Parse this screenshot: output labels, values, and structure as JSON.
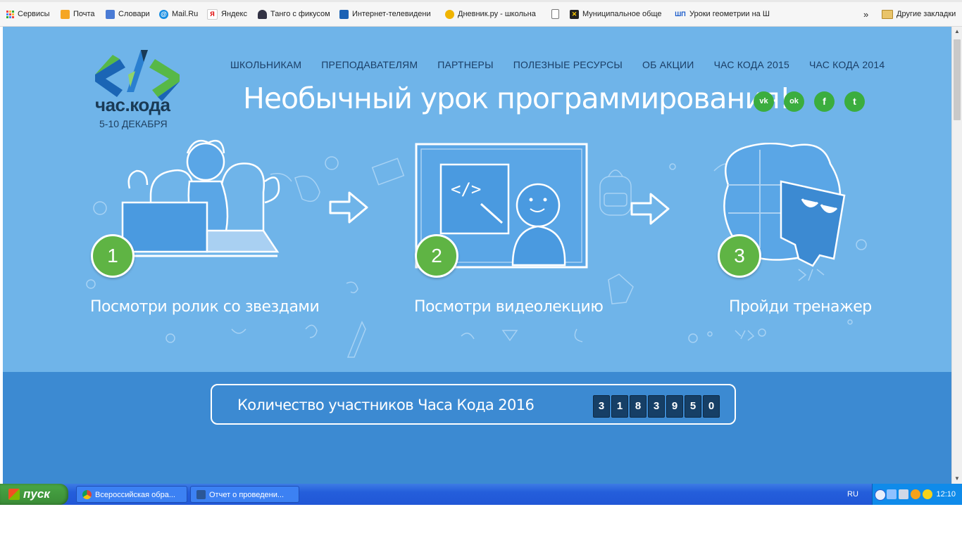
{
  "bookmarks": {
    "items": [
      {
        "label": "Сервисы",
        "icon": "apps-grid-icon",
        "color": "#e44"
      },
      {
        "label": "Почта",
        "icon": "mail-icon",
        "color": "#f5a623"
      },
      {
        "label": "Словари",
        "icon": "dictionary-icon",
        "color": "#4a7bd5"
      },
      {
        "label": "Mail.Ru",
        "icon": "mailru-icon",
        "color": "#168de2"
      },
      {
        "label": "Яндекс",
        "icon": "yandex-icon",
        "color": "#d00"
      },
      {
        "label": "Танго с фикусом",
        "icon": "person-icon",
        "color": "#334"
      },
      {
        "label": "Интернет-телевидени",
        "icon": "tv-icon",
        "color": "#1b62b5"
      },
      {
        "label": "Дневник.ру - школьна",
        "icon": "diary-icon",
        "color": "#f0b400"
      },
      {
        "label": "",
        "icon": "page-icon",
        "color": "#888"
      },
      {
        "label": "Муниципальное обще",
        "icon": "municipal-icon",
        "color": "#c22"
      },
      {
        "label": "Уроки геометрии на Ш",
        "icon": "shp-icon",
        "color": "#1558c9"
      }
    ],
    "overflow": "»",
    "other": "Другие закладки"
  },
  "site": {
    "logo_text": "час.кода",
    "logo_date": "5-10 ДЕКАБРЯ",
    "nav": [
      "ШКОЛЬНИКАМ",
      "ПРЕПОДАВАТЕЛЯМ",
      "ПАРТНЕРЫ",
      "ПОЛЕЗНЫЕ РЕСУРСЫ",
      "ОБ АКЦИИ",
      "ЧАС КОДА 2015",
      "ЧАС КОДА 2014"
    ],
    "headline": "Необычный урок программирования!",
    "social": [
      {
        "name": "vk",
        "glyph": "vk"
      },
      {
        "name": "odnoklassniki",
        "glyph": "ok"
      },
      {
        "name": "facebook",
        "glyph": "f"
      },
      {
        "name": "twitter",
        "glyph": "t"
      }
    ],
    "steps": [
      {
        "number": "1",
        "label": "Посмотри ролик со звездами"
      },
      {
        "number": "2",
        "label": "Посмотри видеолекцию"
      },
      {
        "number": "3",
        "label": "Пройди тренажер"
      }
    ],
    "counter": {
      "title": "Количество участников Часа Кода 2016",
      "digits": [
        "3",
        "1",
        "8",
        "3",
        "9",
        "5",
        "0"
      ]
    }
  },
  "taskbar": {
    "start_label": "пуск",
    "tasks": [
      {
        "label": "Всероссийская обра...",
        "icon": "chrome-icon"
      },
      {
        "label": "Отчет о проведени...",
        "icon": "word-icon"
      }
    ],
    "lang": "RU",
    "clock": "12:10"
  },
  "colors": {
    "hero_bg": "#6fb4e9",
    "band_bg": "#3c8ad2",
    "step_green": "#5fb444",
    "social_green": "#3bad3e",
    "counter_digit_bg": "#163f66"
  }
}
